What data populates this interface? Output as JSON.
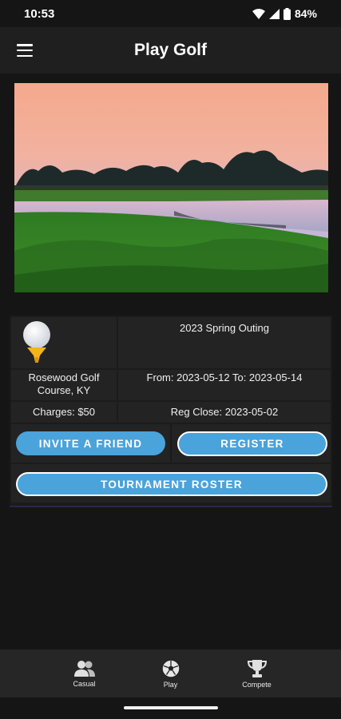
{
  "status": {
    "time": "10:53",
    "battery": "84%"
  },
  "app": {
    "title": "Play Golf"
  },
  "event": {
    "name": "2023 Spring Outing",
    "course": "Rosewood Golf Course, KY",
    "dates": "From: 2023-05-12 To: 2023-05-14",
    "charges": "Charges: $50",
    "reg_close": "Reg Close: 2023-05-02"
  },
  "buttons": {
    "invite": "INVITE A FRIEND",
    "register": "REGISTER",
    "roster": "TOURNAMENT ROSTER"
  },
  "nav": [
    {
      "label": "Casual",
      "icon": "people-icon"
    },
    {
      "label": "Play",
      "icon": "soccer-ball-icon"
    },
    {
      "label": "Compete",
      "icon": "trophy-icon"
    }
  ]
}
